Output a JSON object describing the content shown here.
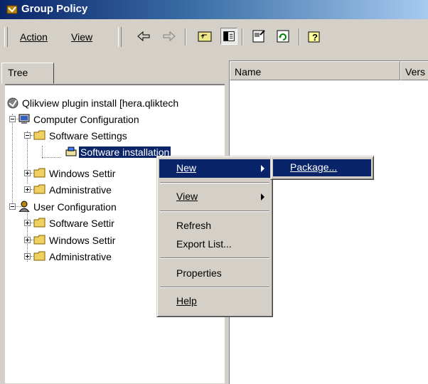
{
  "window": {
    "title": "Group Policy"
  },
  "menubar": {
    "action": "Action",
    "view": "View"
  },
  "toolbar": {
    "buttons": [
      "back-icon",
      "forward-icon",
      "up-folder-icon",
      "show-hide-tree-icon",
      "properties-icon",
      "refresh-icon",
      "help-icon"
    ]
  },
  "tree": {
    "tab_label": "Tree",
    "nodes": [
      {
        "label": "Qlikview plugin install [hera.qliktech",
        "icon": "policy-icon"
      },
      {
        "label": "Computer Configuration",
        "icon": "computer-icon"
      },
      {
        "label": "Software Settings",
        "icon": "folder-icon"
      },
      {
        "label": "Software installation",
        "icon": "software-install-icon",
        "selected": true
      },
      {
        "label": "Windows Settir",
        "icon": "folder-icon"
      },
      {
        "label": "Administrative",
        "icon": "folder-icon"
      },
      {
        "label": "User Configuration",
        "icon": "user-icon"
      },
      {
        "label": "Software Settir",
        "icon": "folder-icon"
      },
      {
        "label": "Windows Settir",
        "icon": "folder-icon"
      },
      {
        "label": "Administrative",
        "icon": "folder-icon"
      }
    ]
  },
  "list": {
    "columns": [
      "Name",
      "Vers"
    ]
  },
  "context_menu": {
    "items": [
      {
        "label": "New",
        "submenu": true,
        "highlighted": true
      },
      {
        "label": "View",
        "submenu": true
      },
      {
        "label": "Refresh"
      },
      {
        "label": "Export List..."
      },
      {
        "label": "Properties"
      },
      {
        "label": "Help"
      }
    ]
  },
  "submenu": {
    "items": [
      {
        "label": "Package...",
        "highlighted": true
      }
    ]
  }
}
